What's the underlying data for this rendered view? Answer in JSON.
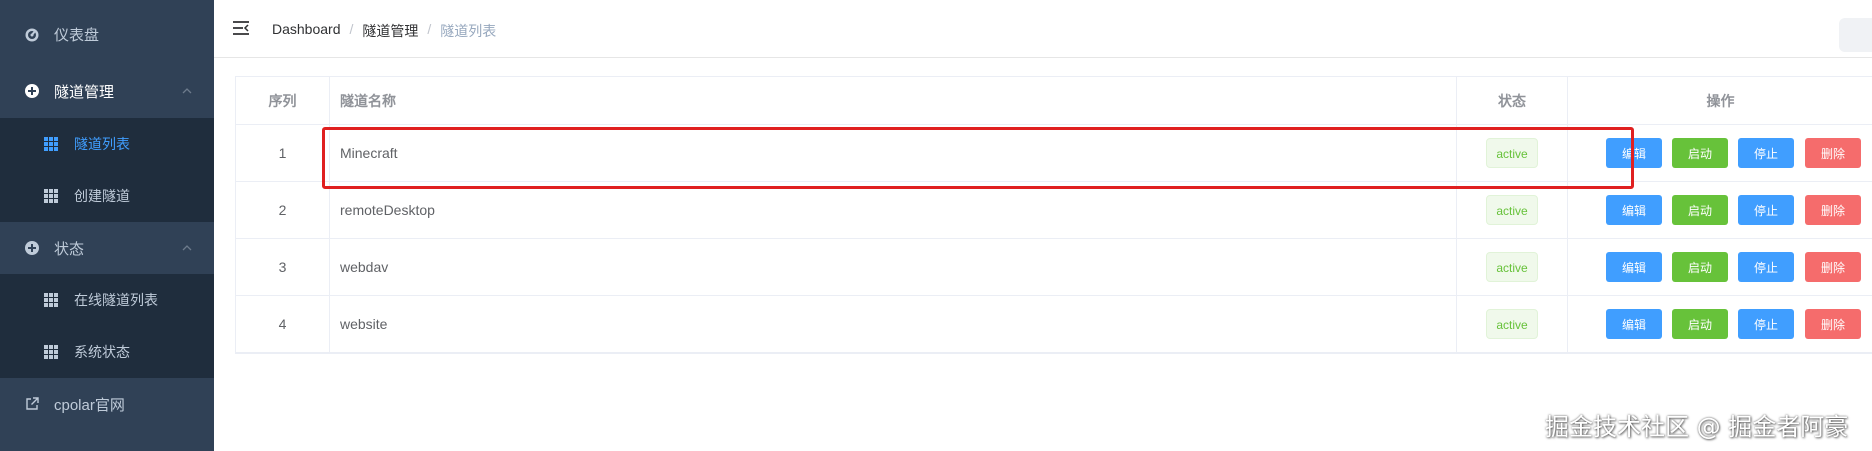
{
  "sidebar": {
    "dashboard": {
      "label": "仪表盘",
      "icon": "dashboard-icon"
    },
    "tunnel_mgmt": {
      "label": "隧道管理",
      "icon": "circle-plus-icon"
    },
    "tunnel_list": {
      "label": "隧道列表",
      "icon": "grid-icon",
      "active": true
    },
    "create_tunnel": {
      "label": "创建隧道",
      "icon": "grid-icon"
    },
    "status": {
      "label": "状态",
      "icon": "circle-plus-icon"
    },
    "online_tunnels": {
      "label": "在线隧道列表",
      "icon": "grid-icon"
    },
    "system_status": {
      "label": "系统状态",
      "icon": "grid-icon"
    },
    "cpolar_site": {
      "label": "cpolar官网",
      "icon": "external-link-icon"
    }
  },
  "header": {
    "breadcrumb": [
      "Dashboard",
      "隧道管理",
      "隧道列表"
    ],
    "separator": "/"
  },
  "table": {
    "headers": {
      "index": "序列",
      "name": "隧道名称",
      "status": "状态",
      "ops": "操作"
    },
    "rows": [
      {
        "index": "1",
        "name": "Minecraft",
        "status": "active"
      },
      {
        "index": "2",
        "name": "remoteDesktop",
        "status": "active"
      },
      {
        "index": "3",
        "name": "webdav",
        "status": "active"
      },
      {
        "index": "4",
        "name": "website",
        "status": "active"
      }
    ],
    "actions": {
      "edit": "编辑",
      "start": "启动",
      "stop": "停止",
      "delete": "删除"
    }
  },
  "watermark": "掘金技术社区 @ 掘金者阿豪",
  "colors": {
    "sidebar_bg": "#304156",
    "submenu_bg": "#1f2d3d",
    "active": "#409eff",
    "success": "#67c23a",
    "danger": "#f56c6c",
    "highlight_box": "#e02020"
  }
}
